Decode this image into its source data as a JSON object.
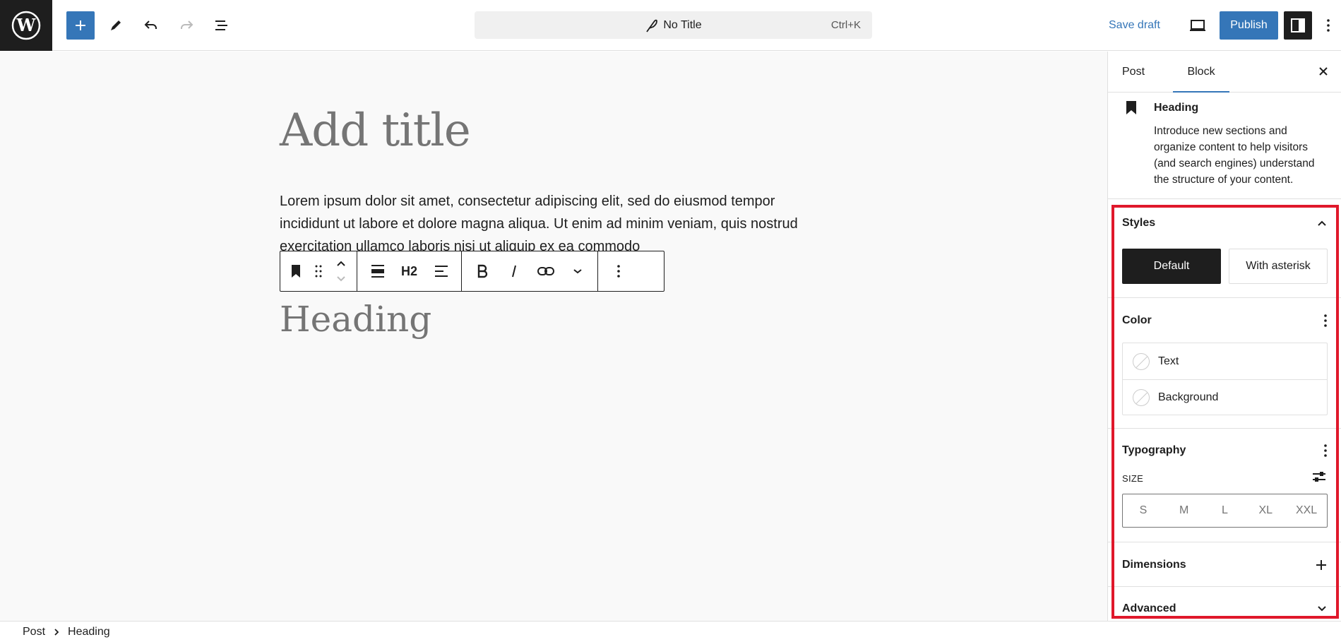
{
  "header": {
    "document_title": "No Title",
    "command_shortcut": "Ctrl+K",
    "save_draft_label": "Save draft",
    "publish_label": "Publish"
  },
  "editor": {
    "title_placeholder": "Add title",
    "paragraph_text": "Lorem ipsum dolor sit amet, consectetur adipiscing elit, sed do eiusmod tempor incididunt ut labore et dolore magna aliqua. Ut enim ad minim veniam, quis nostrud exercitation ullamco laboris nisi ut aliquip ex ea commodo",
    "heading_placeholder": "Heading",
    "toolbar_heading_level": "H2"
  },
  "sidebar": {
    "tabs": [
      {
        "label": "Post"
      },
      {
        "label": "Block"
      }
    ],
    "block_card": {
      "title": "Heading",
      "description": "Introduce new sections and organize content to help visitors (and search engines) understand the structure of your content."
    },
    "styles": {
      "title": "Styles",
      "options": [
        "Default",
        "With asterisk"
      ]
    },
    "color": {
      "title": "Color",
      "items": [
        "Text",
        "Background"
      ]
    },
    "typography": {
      "title": "Typography",
      "size_label": "SIZE",
      "sizes": [
        "S",
        "M",
        "L",
        "XL",
        "XXL"
      ]
    },
    "dimensions": {
      "title": "Dimensions"
    },
    "advanced": {
      "title": "Advanced"
    }
  },
  "footer": {
    "breadcrumb": [
      "Post",
      "Heading"
    ]
  },
  "colors": {
    "accent": "#3576b8",
    "highlight": "#e0182b",
    "dark": "#1e1e1e"
  }
}
